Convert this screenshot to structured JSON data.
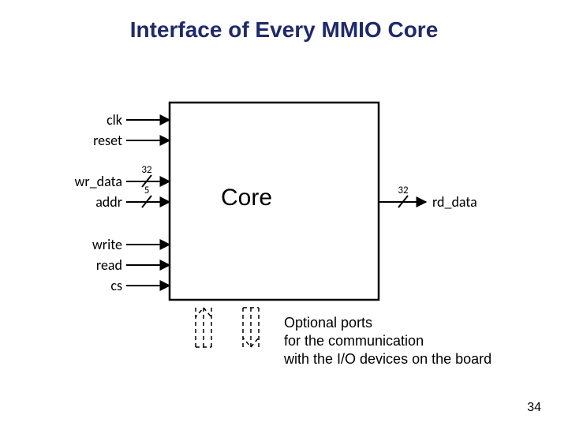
{
  "title": "Interface of Every MMIO Core",
  "core_label": "Core",
  "signals": {
    "left": [
      {
        "name": "clk"
      },
      {
        "name": "reset"
      },
      {
        "name": "wr_data",
        "width": "32"
      },
      {
        "name": "addr",
        "width": "5"
      },
      {
        "name": "write"
      },
      {
        "name": "read"
      },
      {
        "name": "cs"
      }
    ],
    "right": [
      {
        "name": "rd_data",
        "width": "32"
      }
    ]
  },
  "optional_ports": {
    "line1": "Optional ports",
    "line2": "for the communication",
    "line3": "with the I/O devices on the board"
  },
  "page": "34"
}
